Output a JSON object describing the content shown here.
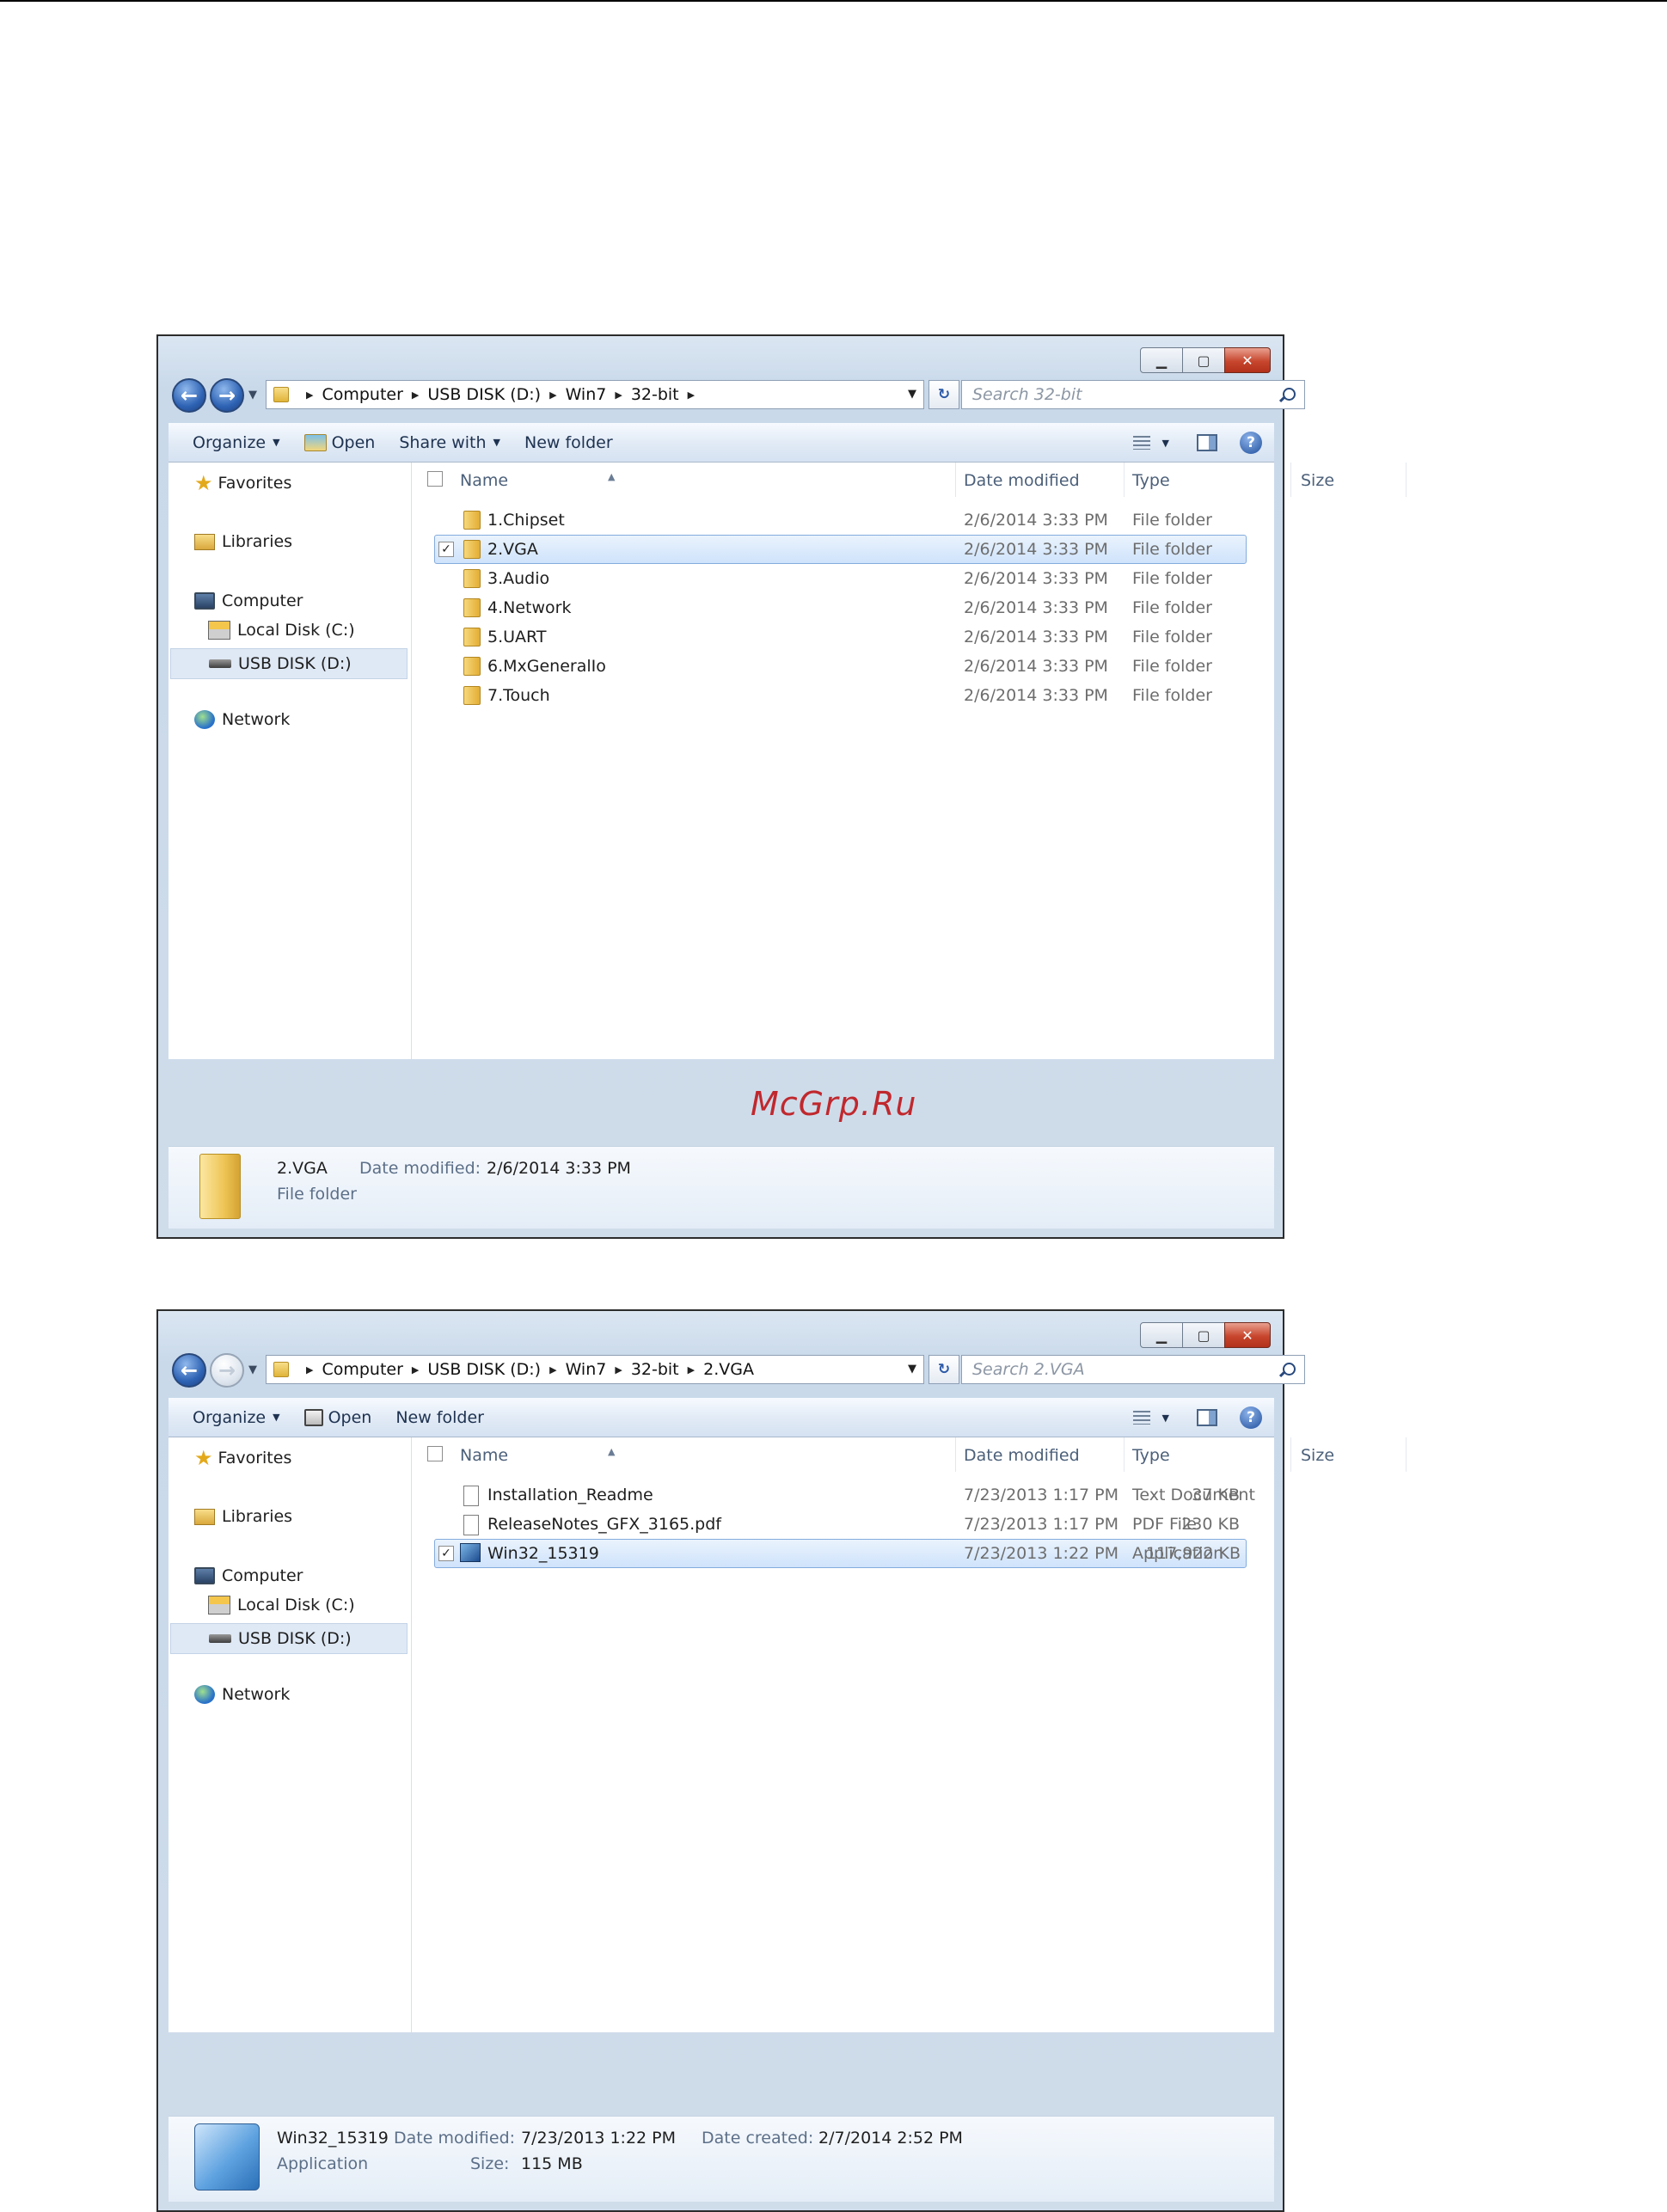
{
  "watermark": "McGrp.Ru",
  "window1": {
    "breadcrumb": [
      "Computer",
      "USB DISK (D:)",
      "Win7",
      "32-bit"
    ],
    "search_placeholder": "Search 32-bit",
    "toolbar": {
      "organize": "Organize",
      "open": "Open",
      "share_with": "Share with",
      "new_folder": "New folder"
    },
    "nav": {
      "favorites": "Favorites",
      "libraries": "Libraries",
      "computer": "Computer",
      "local_disk": "Local Disk (C:)",
      "usb_disk": "USB DISK (D:)",
      "network": "Network"
    },
    "columns": {
      "name": "Name",
      "date": "Date modified",
      "type": "Type",
      "size": "Size"
    },
    "rows": [
      {
        "name": "1.Chipset",
        "date": "2/6/2014 3:33 PM",
        "type": "File folder"
      },
      {
        "name": "2.VGA",
        "date": "2/6/2014 3:33 PM",
        "type": "File folder",
        "selected": true
      },
      {
        "name": "3.Audio",
        "date": "2/6/2014 3:33 PM",
        "type": "File folder"
      },
      {
        "name": "4.Network",
        "date": "2/6/2014 3:33 PM",
        "type": "File folder"
      },
      {
        "name": "5.UART",
        "date": "2/6/2014 3:33 PM",
        "type": "File folder"
      },
      {
        "name": "6.MxGeneralIo",
        "date": "2/6/2014 3:33 PM",
        "type": "File folder"
      },
      {
        "name": "7.Touch",
        "date": "2/6/2014 3:33 PM",
        "type": "File folder"
      }
    ],
    "details": {
      "name": "2.VGA",
      "date_label": "Date modified:",
      "date_value": "2/6/2014 3:33 PM",
      "type": "File folder"
    }
  },
  "window2": {
    "breadcrumb": [
      "Computer",
      "USB DISK (D:)",
      "Win7",
      "32-bit",
      "2.VGA"
    ],
    "search_placeholder": "Search 2.VGA",
    "toolbar": {
      "organize": "Organize",
      "open": "Open",
      "new_folder": "New folder"
    },
    "nav": {
      "favorites": "Favorites",
      "libraries": "Libraries",
      "computer": "Computer",
      "local_disk": "Local Disk (C:)",
      "usb_disk": "USB DISK (D:)",
      "network": "Network"
    },
    "columns": {
      "name": "Name",
      "date": "Date modified",
      "type": "Type",
      "size": "Size"
    },
    "rows": [
      {
        "name": "Installation_Readme",
        "date": "7/23/2013 1:17 PM",
        "type": "Text Document",
        "size": "37 KB"
      },
      {
        "name": "ReleaseNotes_GFX_3165.pdf",
        "date": "7/23/2013 1:17 PM",
        "type": "PDF File",
        "size": "230 KB"
      },
      {
        "name": "Win32_15319",
        "date": "7/23/2013 1:22 PM",
        "type": "Application",
        "size": "117,922 KB",
        "selected": true
      }
    ],
    "details": {
      "name": "Win32_15319",
      "type": "Application",
      "date_label": "Date modified:",
      "date_value": "7/23/2013 1:22 PM",
      "created_label": "Date created:",
      "created_value": "2/7/2014 2:52 PM",
      "size_label": "Size:",
      "size_value": "115 MB"
    }
  }
}
